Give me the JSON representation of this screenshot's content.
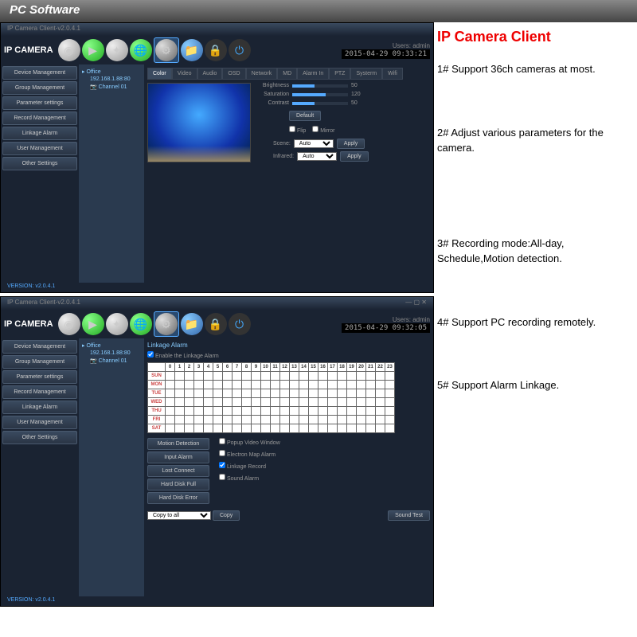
{
  "header": {
    "title": "PC Software"
  },
  "right": {
    "title": "IP Camera Client",
    "features": [
      "1# Support 36ch cameras at most.",
      "2# Adjust various parameters for the camera.",
      "3# Recording mode:All-day, Schedule,Motion detection.",
      "4# Support PC recording remotely.",
      "5# Support Alarm Linkage."
    ]
  },
  "app": {
    "titlebar": "IP Camera Client-v2.0.4.1",
    "logo": "IP CAMERA",
    "user_label": "Users: admin",
    "timestamp1": "2015-04-29 09:33:21",
    "timestamp2": "2015-04-29 09:32:05",
    "version": "VERSION: v2.0.4.1",
    "sidebar": [
      "Device Management",
      "Group Management",
      "Parameter settings",
      "Record Management",
      "Linkage Alarm",
      "User Management",
      "Other Settings"
    ],
    "tree": {
      "root": "Office",
      "ip": "192.168.1.88:80",
      "channel": "Channel 01"
    },
    "tabs": [
      "Color",
      "Video",
      "Audio",
      "OSD",
      "Network",
      "MD",
      "Alarm In",
      "PTZ",
      "Systerm",
      "Wifi"
    ],
    "sliders": {
      "brightness": {
        "label": "Brightness",
        "value": 50
      },
      "saturation": {
        "label": "Saturation",
        "value": 120
      },
      "contrast": {
        "label": "Contrast",
        "value": 50
      }
    },
    "default_btn": "Default",
    "flip": "Flip",
    "mirror": "Mirror",
    "scene": {
      "label": "Scene:",
      "value": "Auto"
    },
    "infrared": {
      "label": "Infrared:",
      "value": "Auto"
    },
    "apply": "Apply"
  },
  "linkage": {
    "title": "Linkage Alarm",
    "enable": "Enable the Linkage Alarm",
    "hours": [
      "0",
      "1",
      "2",
      "3",
      "4",
      "5",
      "6",
      "7",
      "8",
      "9",
      "10",
      "11",
      "12",
      "13",
      "14",
      "15",
      "16",
      "17",
      "18",
      "19",
      "20",
      "21",
      "22",
      "23"
    ],
    "days": [
      "SUN",
      "MON",
      "TUE",
      "WED",
      "THU",
      "FRI",
      "SAT"
    ],
    "buttons": [
      "Motion Detection",
      "Input Alarm",
      "Lost Connect",
      "Hard Disk Full",
      "Hard Disk Error"
    ],
    "checks": [
      "Popup Video Window",
      "Electron Map Alarm",
      "Linkage Record",
      "Sound Alarm"
    ],
    "copy_label": "Copy to all",
    "copy_btn": "Copy",
    "sound_test": "Sound Test"
  }
}
